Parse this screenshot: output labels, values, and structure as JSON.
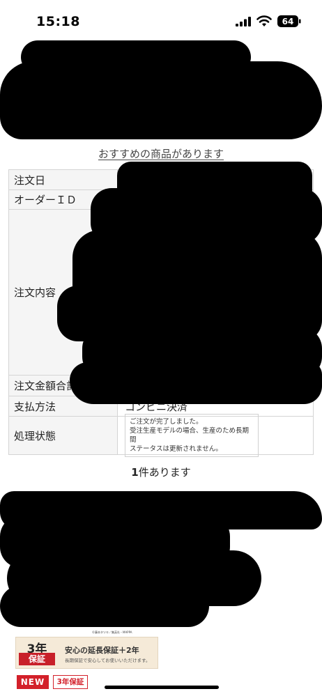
{
  "status_bar": {
    "time": "15:18",
    "battery": "64"
  },
  "recommend_link": "おすすめの商品があります",
  "order_table": {
    "rows": [
      {
        "label": "注文日",
        "value": ""
      },
      {
        "label": "オーダーＩＤ",
        "value": ""
      },
      {
        "label": "注文内容",
        "value": ""
      },
      {
        "label": "注文金額合計",
        "value": ""
      },
      {
        "label": "支払方法",
        "value": "コンビニ決済"
      },
      {
        "label": "処理状態",
        "status_lines": [
          "ご注文が完了しました。",
          "受注生産モデルの場合、生産のため長期間",
          "ステータスは更新されません。"
        ]
      }
    ]
  },
  "result_count": {
    "number": "1",
    "suffix": "件あります"
  },
  "banner": {
    "badge_top": "3年",
    "badge_ribbon": "保証",
    "title": "安心の延長保証＋2年",
    "subtitle": "長期保証で安心してお使いいただけます。",
    "fine_print": "©藤本タツキ／集英社・MAPPA"
  },
  "tags": {
    "new": "NEW",
    "warranty": "3年保証"
  },
  "colors": {
    "accent_red": "#d3202a",
    "redaction": "#000000",
    "label_bg": "#f5f5f5"
  }
}
